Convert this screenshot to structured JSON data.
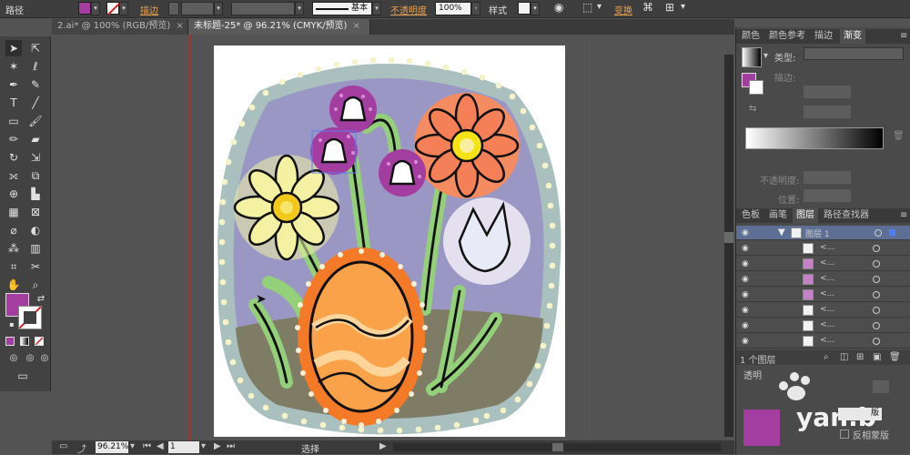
{
  "control_bar": {
    "object_type": "路径",
    "fill_color": "#a33ea0",
    "stroke_label": "描边",
    "stroke_style": "基本",
    "opacity_label": "不透明度",
    "opacity_value": "100%",
    "style_label": "样式",
    "transform_label": "变换"
  },
  "tabs": [
    {
      "label": "2.ai* @ 100% (RGB/预览)",
      "close": "×"
    },
    {
      "label": "未标题-25* @ 96.21% (CMYK/预览)",
      "close": "×"
    }
  ],
  "tools": {
    "fill_color": "#a33ea0"
  },
  "status": {
    "zoom": "96.21%",
    "page": "1",
    "tool": "选择"
  },
  "color_panel": {
    "tabs": [
      "颜色",
      "颜色参考",
      "描边",
      "渐变"
    ],
    "active_tab": "渐变",
    "type_label": "类型:",
    "stroke_label": "描边:",
    "opacity_label": "不透明度:",
    "location_label": "位置:"
  },
  "layers_panel": {
    "tabs": [
      "色板",
      "画笔",
      "图层",
      "路径查找器"
    ],
    "active_tab": "图层",
    "layer_name": "图层 1",
    "sublayer_name": "<...",
    "count": "1 个图层"
  },
  "transparency_panel": {
    "title": "透明",
    "make_mask": "版",
    "invert_mask": "反相蒙版"
  },
  "watermark": {
    "text": "yan.b"
  },
  "colors": {
    "purple": "#a33ea0",
    "bg_oval": "#9b97c4",
    "outer_ring": "#aac0bf",
    "ground": "#7e7c65",
    "egg": "#f47a27",
    "green_stem": "#94cf7a",
    "flower_orange": "#f57f57",
    "flower_yellow_petal": "#f4f2a2"
  }
}
